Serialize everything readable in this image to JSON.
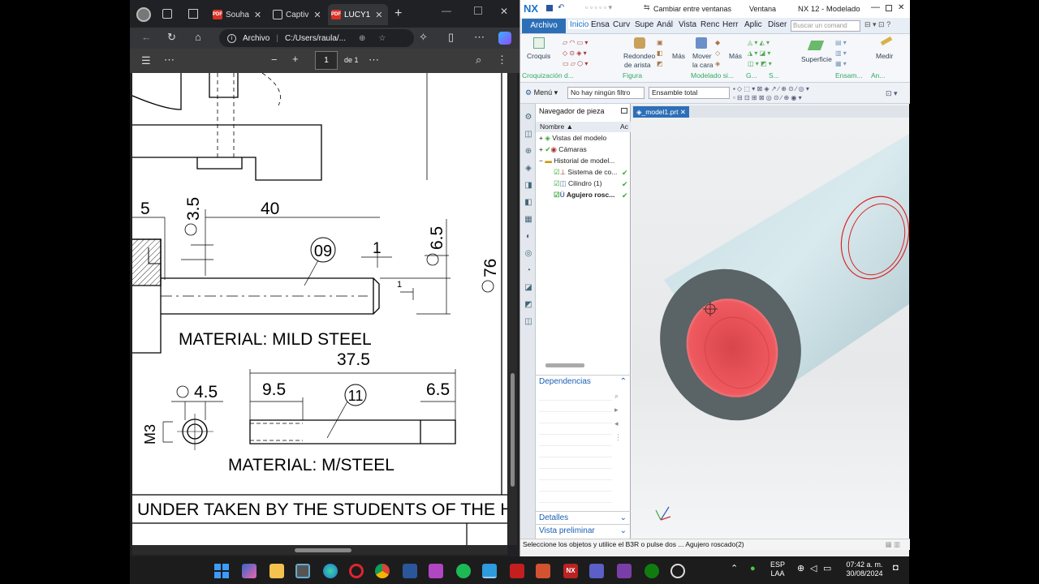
{
  "browser": {
    "tabs": [
      {
        "label": "Souha"
      },
      {
        "label": "Captiv"
      },
      {
        "label": "LUCY1"
      }
    ],
    "address_label": "Archivo",
    "address_path": "C:/Users/raula/...",
    "pdf": {
      "page_current": "1",
      "page_total": "de 1"
    }
  },
  "drawing": {
    "dims": {
      "d5": "5",
      "d35": "3.5",
      "d40": "40",
      "d1": "1",
      "d65": "6.5",
      "d76": "76",
      "d1b": "1",
      "d375": "37.5",
      "d95": "9.5",
      "d65b": "6.5",
      "d45": "4.5",
      "m3": "M3"
    },
    "balloons": {
      "b09": "09",
      "b11": "11"
    },
    "material1": "MATERIAL: MILD STEEL",
    "material2": "MATERIAL: M/STEEL",
    "footer": "UNDER TAKEN BY THE STUDENTS OF THE H"
  },
  "nx": {
    "brand": "NX",
    "switch_windows": "Cambiar entre ventanas",
    "window_menu": "Ventana",
    "title": "NX 12 - Modelado",
    "ribbon_tabs": [
      "Archivo",
      "Inicio",
      "Ensa",
      "Curv",
      "Supe",
      "Anál",
      "Vista",
      "Renc",
      "Herr",
      "Aplic",
      "Diser"
    ],
    "search_placeholder": "Buscar un comand",
    "ribbon": {
      "croquis": "Croquis",
      "redondeo": "Redondeo",
      "de_arista": "de arista",
      "mas1": "Más",
      "mover": "Mover",
      "la_cara": "la cara",
      "mas2": "Más",
      "superficie": "Superficie",
      "medir": "Medir"
    },
    "groups": [
      "Croquización d...",
      "Figura",
      "Modelado si...",
      "G...",
      "S...",
      "Ensam...",
      "An..."
    ],
    "menu_label": "Menú",
    "filter": "No hay ningún filtro",
    "assembly": "Ensamble total",
    "navigator_title": "Navegador de pieza",
    "tree_col_name": "Nombre",
    "tree_col_2": "Ac",
    "tree": [
      "Vistas del modelo",
      "Cámaras",
      "Historial de model...",
      "Sistema de co...",
      "Cilindro (1)",
      "Agujero rosc..."
    ],
    "sections": {
      "dependencias": "Dependencias",
      "detalles": "Detalles",
      "vista_preliminar": "Vista preliminar"
    },
    "viewport_tab": "_model1.prt",
    "status": "Seleccione los objetos y utilice el B3R o pulse dos ... Agujero roscado(2)",
    "colors": {
      "cylinder": "#cfe3e8",
      "highlight": "#e8474c",
      "accent": "#1a73c8"
    }
  },
  "taskbar": {
    "lang1": "ESP",
    "lang2": "LAA",
    "time": "07:42 a. m.",
    "date": "30/08/2024"
  }
}
